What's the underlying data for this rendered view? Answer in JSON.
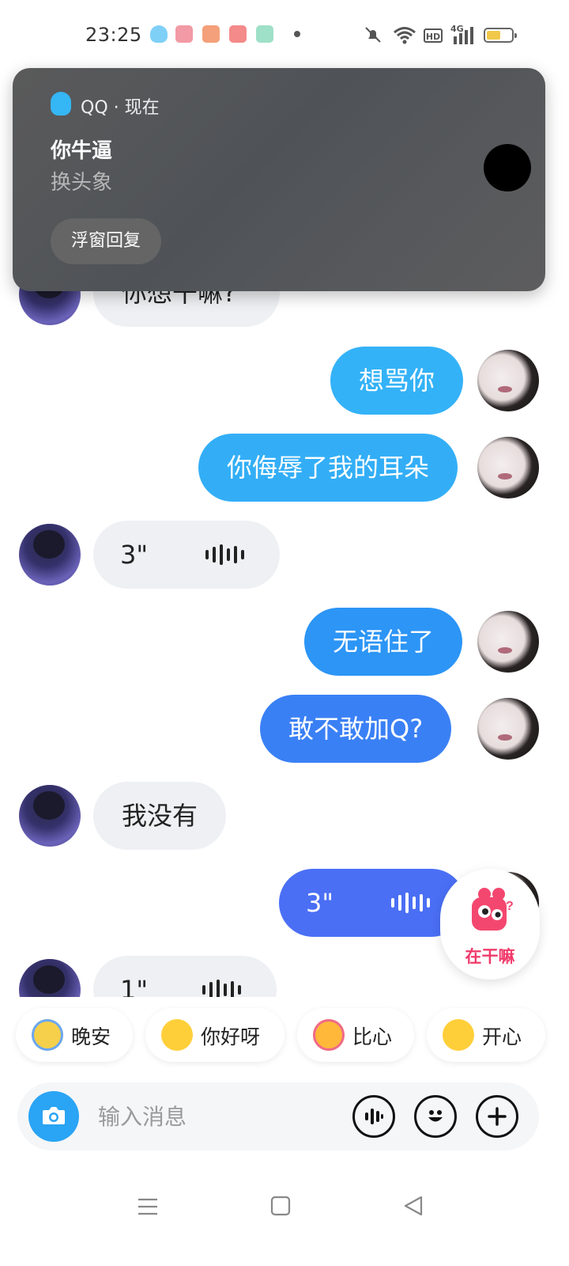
{
  "status_bar": {
    "time": "23:25",
    "network_label": "4G",
    "hd_label": "HD",
    "battery_level": 0.55
  },
  "notification": {
    "app_name": "QQ · 现在",
    "title": "你牛逼",
    "body": "换头象",
    "action_label": "浮窗回复"
  },
  "messages": [
    {
      "side": "in",
      "type": "text",
      "text": "你想干嘛?"
    },
    {
      "side": "out",
      "type": "text",
      "text": "想骂你"
    },
    {
      "side": "out",
      "type": "text",
      "text": "你侮辱了我的耳朵"
    },
    {
      "side": "in",
      "type": "voice",
      "duration": "3\""
    },
    {
      "side": "out",
      "type": "text",
      "text": "无语住了"
    },
    {
      "side": "out",
      "type": "text",
      "text": "敢不敢加Q?"
    },
    {
      "side": "in",
      "type": "text",
      "text": "我没有"
    },
    {
      "side": "out",
      "type": "voice",
      "duration": "3\""
    },
    {
      "side": "in",
      "type": "voice",
      "duration": "1\""
    }
  ],
  "floating_badge": {
    "label": "在干嘛"
  },
  "quick_replies": [
    {
      "label": "晚安",
      "icon": "sleepy-emoji-icon"
    },
    {
      "label": "你好呀",
      "icon": "laughing-emoji-icon"
    },
    {
      "label": "比心",
      "icon": "hearts-emoji-icon"
    },
    {
      "label": "开心",
      "icon": "happy-emoji-icon"
    }
  ],
  "input": {
    "placeholder": "输入消息"
  },
  "colors": {
    "bubble_out_light": "#35b0f7",
    "bubble_out_dark": "#4a6ff5",
    "bubble_in": "#eef0f3",
    "accent_pink": "#f03a6a"
  }
}
